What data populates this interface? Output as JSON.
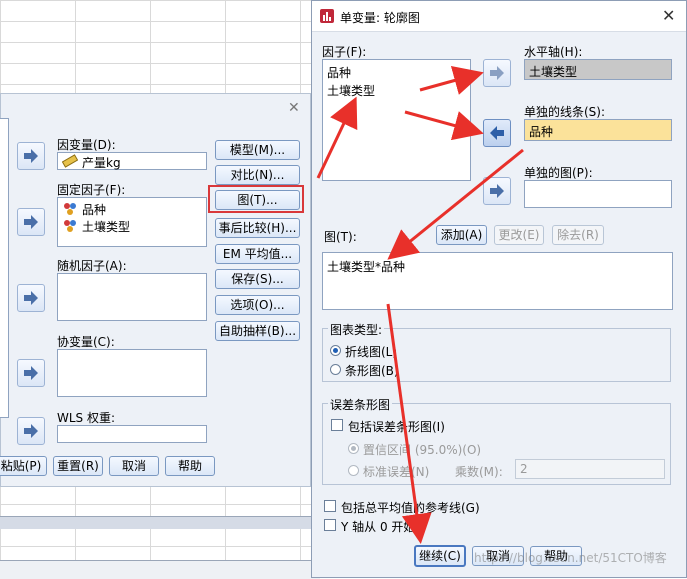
{
  "colors": {
    "red_arrow": "#e8302a",
    "highlight_box": "#d9383a",
    "selected_field": "#fbe29a"
  },
  "left_dialog": {
    "dependent_label": "因变量(D):",
    "dependent_value": "产量kg",
    "fixed_label": "固定因子(F):",
    "fixed_items": [
      "品种",
      "土壤类型"
    ],
    "random_label": "随机因子(A):",
    "covariate_label": "协变量(C):",
    "wls_label": "WLS 权重:",
    "side_buttons": [
      "模型(M)...",
      "对比(N)...",
      "图(T)...",
      "事后比较(H)...",
      "EM 平均值...",
      "保存(S)...",
      "选项(O)...",
      "自助抽样(B)..."
    ],
    "bottom_buttons": [
      "粘贴(P)",
      "重置(R)",
      "取消",
      "帮助"
    ]
  },
  "right_dialog": {
    "title": "单变量: 轮廓图",
    "factors_label": "因子(F):",
    "factors": [
      "品种",
      "土壤类型"
    ],
    "horizontal_label": "水平轴(H):",
    "horizontal_value": "土壤类型",
    "separate_lines_label": "单独的线条(S):",
    "separate_lines_value": "品种",
    "separate_plots_label": "单独的图(P):",
    "plots_label": "图(T):",
    "add_button": "添加(A)",
    "change_button": "更改(E)",
    "remove_button": "除去(R)",
    "plot_item": "土壤类型*品种",
    "chart_type_legend": "图表类型:",
    "line_chart": "折线图(L)",
    "bar_chart": "条形图(B)",
    "error_bars_legend": "误差条形图",
    "include_error_bars": "包括误差条形图(I)",
    "confidence_interval": "置信区间 (95.0%)(O)",
    "standard_error": "标准误差(N)",
    "multiplier_label": "乘数(M):",
    "multiplier_value": "2",
    "include_grand_mean": "包括总平均值的参考线(G)",
    "y_axis_zero": "Y 轴从 0 开始",
    "continue_button": "继续(C)",
    "cancel_button": "取消",
    "help_button": "帮助",
    "close_icon": "close-icon"
  },
  "watermark": "https://blog.csdn.net/51CTO博客"
}
